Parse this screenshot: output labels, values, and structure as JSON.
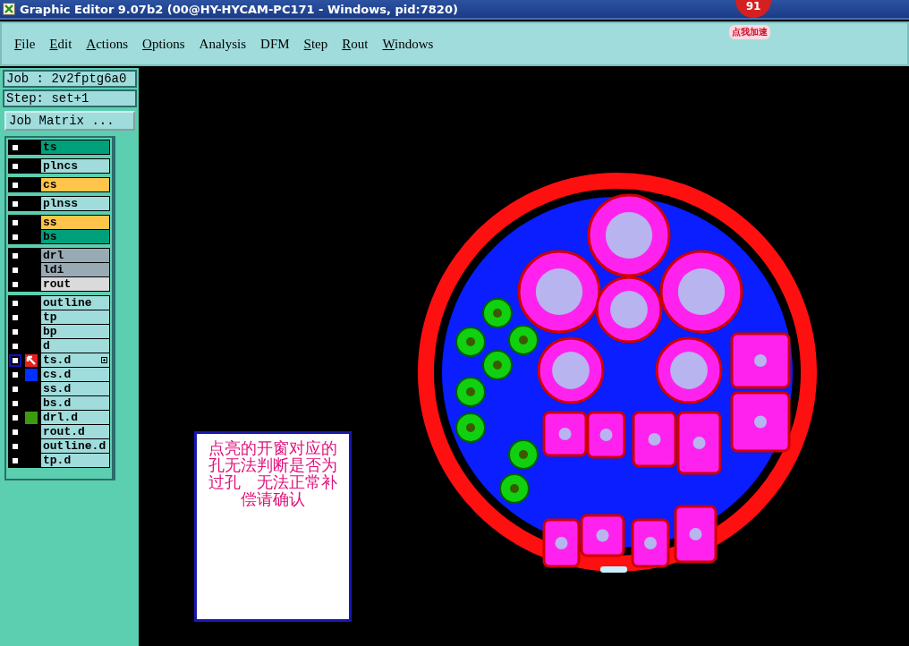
{
  "window": {
    "title": "Graphic Editor 9.07b2 (00@HY-HYCAM-PC171 - Windows, pid:7820)"
  },
  "overlay_badge": {
    "count": "91",
    "label": "点我加速"
  },
  "menu": [
    {
      "label": "File",
      "underlined": true
    },
    {
      "label": "Edit",
      "underlined": true
    },
    {
      "label": "Actions",
      "underlined": true
    },
    {
      "label": "Options",
      "underlined": true
    },
    {
      "label": "Analysis",
      "underlined": false
    },
    {
      "label": "DFM",
      "underlined": false
    },
    {
      "label": "Step",
      "underlined": true
    },
    {
      "label": "Rout",
      "underlined": true
    },
    {
      "label": "Windows",
      "underlined": true
    }
  ],
  "job": "Job : 2v2fptg6a0",
  "step": "Step: set+1",
  "job_matrix_button": "Job Matrix ...",
  "layer_groups": [
    {
      "layers": [
        {
          "name": "ts",
          "color": "#00a07c",
          "selected": false
        }
      ]
    },
    {
      "layers": [
        {
          "name": "plncs",
          "color": "#a0dcdc",
          "selected": false
        }
      ]
    },
    {
      "layers": [
        {
          "name": "cs",
          "color": "#ffc44c",
          "selected": false
        }
      ]
    },
    {
      "layers": [
        {
          "name": "plnss",
          "color": "#a0dcdc",
          "selected": false
        }
      ]
    },
    {
      "layers": [
        {
          "name": "ss",
          "color": "#ffc44c",
          "selected": false
        },
        {
          "name": "bs",
          "color": "#00a07c",
          "selected": false
        }
      ]
    },
    {
      "layers": [
        {
          "name": "drl",
          "color": "#98aab4",
          "selected": false
        },
        {
          "name": "ldi",
          "color": "#98aab4",
          "selected": false
        },
        {
          "name": "rout",
          "color": "#dadada",
          "selected": false
        }
      ]
    },
    {
      "layers": [
        {
          "name": "outline",
          "color": "#a0dcdc",
          "selected": false
        },
        {
          "name": "tp",
          "color": "#a0dcdc",
          "selected": false
        },
        {
          "name": "bp",
          "color": "#a0dcdc",
          "selected": false
        },
        {
          "name": "d",
          "color": "#a0dcdc",
          "selected": false
        },
        {
          "name": "ts.d",
          "color": "#a0dcdc",
          "selected": true,
          "marker": {
            "kind": "arrow"
          },
          "expandable": true
        },
        {
          "name": "cs.d",
          "color": "#a0dcdc",
          "selected": false,
          "marker": {
            "kind": "swatch",
            "color": "#0030ff"
          }
        },
        {
          "name": "ss.d",
          "color": "#a0dcdc",
          "selected": false
        },
        {
          "name": "bs.d",
          "color": "#a0dcdc",
          "selected": false
        },
        {
          "name": "drl.d",
          "color": "#a0dcdc",
          "selected": false,
          "marker": {
            "kind": "swatch",
            "color": "#3c9a10"
          }
        },
        {
          "name": "rout.d",
          "color": "#a0dcdc",
          "selected": false
        },
        {
          "name": "outline.d",
          "color": "#a0dcdc",
          "selected": false
        },
        {
          "name": "tp.d",
          "color": "#a0dcdc",
          "selected": false
        }
      ]
    }
  ],
  "note": {
    "lines": [
      "点亮的开窗对应的",
      "孔无法判断是否为",
      "过孔　无法正常补",
      "偿请确认"
    ]
  }
}
